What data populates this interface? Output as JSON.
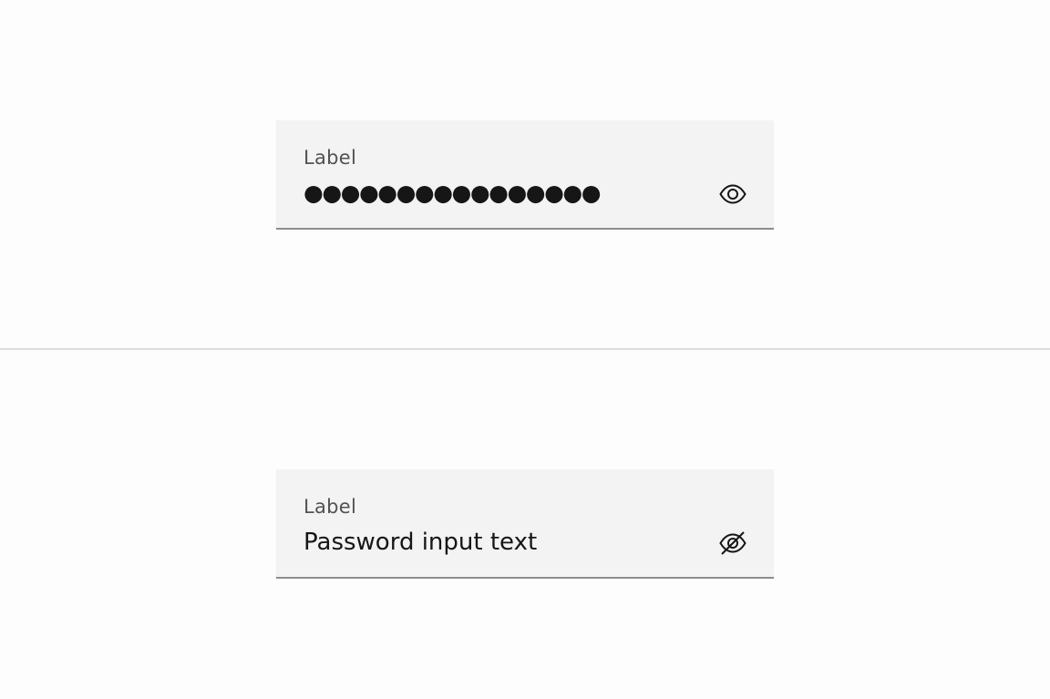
{
  "password_hidden": {
    "label": "Label",
    "value": "●●●●●●●●●●●●●●●●",
    "toggle_icon": "eye-icon"
  },
  "password_visible": {
    "label": "Label",
    "value": "Password input text",
    "toggle_icon": "eye-off-icon"
  },
  "colors": {
    "field_background": "#f3f3f3",
    "field_border": "#8d8d8d",
    "label_text": "#525252",
    "value_text": "#161616",
    "divider": "#dcdcdc"
  }
}
